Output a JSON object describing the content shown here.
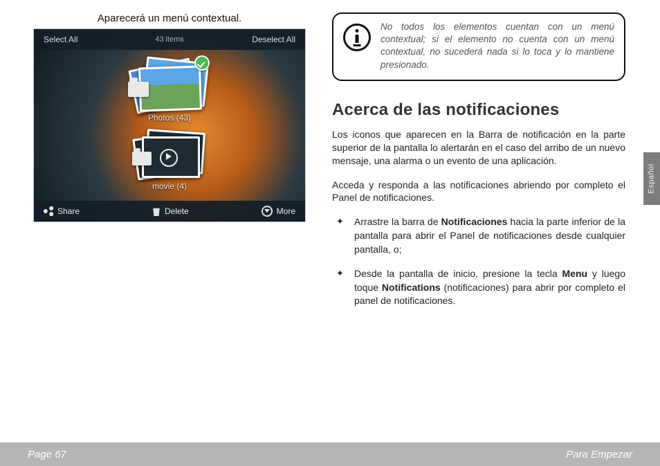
{
  "left": {
    "caption": "Aparecerá un menú contextual.",
    "screenshot": {
      "top": {
        "select_all": "Select All",
        "item_count": "43 items",
        "deselect_all": "Deselect All"
      },
      "groups": {
        "photos_label": "Photos  (43)",
        "movie_label": "movie  (4)"
      },
      "bottom": {
        "share": "Share",
        "delete": "Delete",
        "more": "More"
      }
    }
  },
  "info_box": {
    "text": "No todos los elementos cuentan con un menú contextual; si el elemento no cuenta con un menú contextual, no sucederá nada si lo toca y lo mantiene presionado."
  },
  "section": {
    "title": "Acerca de las notificaciones",
    "para1": "Los iconos que aparecen en la Barra de notificación en la parte superior de la pantalla lo alertarán en el caso del arribo de un nuevo mensaje, una alarma o un evento de una aplicación.",
    "para2": "Acceda y responda a las notificaciones abriendo por completo el Panel de notificaciones.",
    "bullet1_a": "Arrastre la barra de ",
    "bullet1_bold": "Notificaciones",
    "bullet1_b": " hacia la parte inferior de la pantalla para abrir el Panel de notifica­ciones desde cualquier pantalla, o;",
    "bullet2_a": "Desde la pantalla de inicio, presione la tecla ",
    "bullet2_bold1": "Menu",
    "bullet2_b": " y luego toque ",
    "bullet2_bold2": "Notifications",
    "bullet2_c": " (notificaciones) para abrir por completo el panel de notificaciones."
  },
  "side_tab": "Español",
  "footer": {
    "page": "Page 67",
    "chapter": "Para Empezar"
  }
}
